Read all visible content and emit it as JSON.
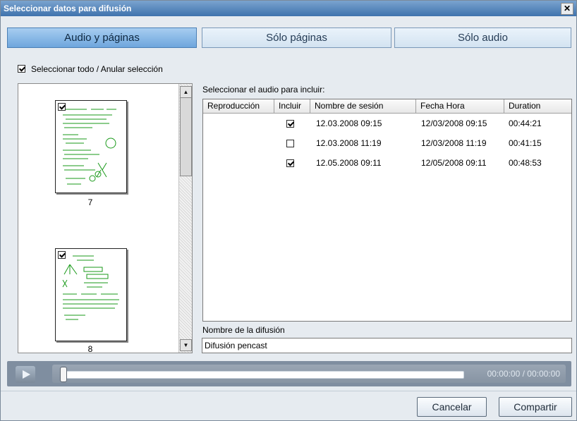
{
  "window": {
    "title": "Seleccionar datos para difusión",
    "close_label": "✕"
  },
  "tabs": [
    {
      "label": "Audio y páginas",
      "active": true
    },
    {
      "label": "Sólo páginas",
      "active": false
    },
    {
      "label": "Sólo audio",
      "active": false
    }
  ],
  "select_all": {
    "label": "Seleccionar todo / Anular selección",
    "checked": true
  },
  "pages": [
    {
      "number": "7",
      "checked": true
    },
    {
      "number": "8",
      "checked": true
    }
  ],
  "audio": {
    "label": "Seleccionar el audio para incluir:",
    "columns": [
      "Reproducción",
      "Incluir",
      "Nombre de sesión",
      "Fecha Hora",
      "Duration"
    ],
    "rows": [
      {
        "include": true,
        "session": "12.03.2008 09:15",
        "datetime": "12/03/2008 09:15",
        "duration": "00:44:21"
      },
      {
        "include": false,
        "session": "12.03.2008 11:19",
        "datetime": "12/03/2008 11:19",
        "duration": "00:41:15"
      },
      {
        "include": true,
        "session": "12.05.2008 09:11",
        "datetime": "12/05/2008 09:11",
        "duration": "00:48:53"
      }
    ]
  },
  "broadcast_name": {
    "label": "Nombre de la difusión",
    "value": "Difusión pencast"
  },
  "player": {
    "timecode": "00:00:00 / 00:00:00",
    "progress": 0
  },
  "buttons": {
    "cancel": "Cancelar",
    "share": "Compartir"
  },
  "colors": {
    "ink": "#1a9a1a",
    "active_tab": "#6ea6dd"
  }
}
